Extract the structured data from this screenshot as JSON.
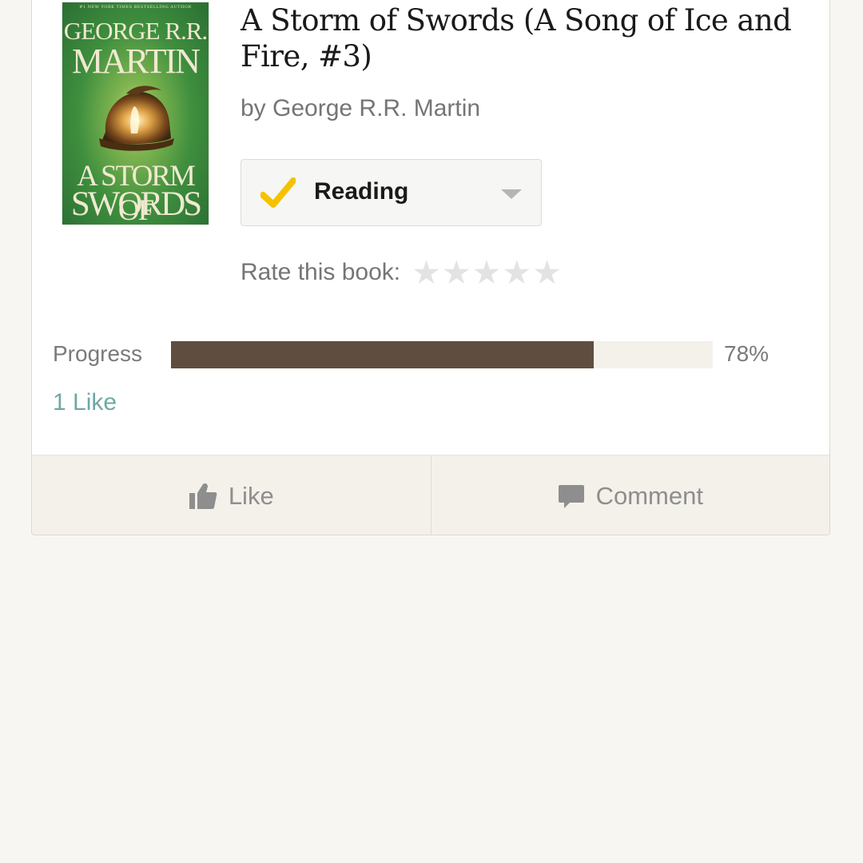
{
  "book": {
    "cover": {
      "tagline": "#1 NEW YORK TIMES BESTSELLING AUTHOR",
      "author_line1": "GEORGE R.R.",
      "author_line2": "MARTIN",
      "title_line1": "A STORM OF",
      "title_line2": "SWORDS"
    },
    "title": "A Storm of Swords (A Song of Ice and Fire, #3)",
    "byline": "by George R.R. Martin",
    "shelf": {
      "label": "Reading",
      "icon": "check-icon",
      "accent_color": "#f5c200"
    },
    "rating": {
      "label": "Rate this book:",
      "stars": [
        "★",
        "★",
        "★",
        "★",
        "★"
      ],
      "value": 0
    },
    "progress": {
      "label": "Progress",
      "value_text": "78%",
      "fraction": 0.78,
      "fill_color": "#5f4e3f"
    },
    "likes_text": "1 Like"
  },
  "actions": {
    "like": {
      "label": "Like",
      "icon": "thumbs-up-icon"
    },
    "comment": {
      "label": "Comment",
      "icon": "comment-icon"
    }
  },
  "colors": {
    "background": "#f8f6f2",
    "link": "#6fa8a3",
    "action_bar": "#f4f1ea"
  }
}
